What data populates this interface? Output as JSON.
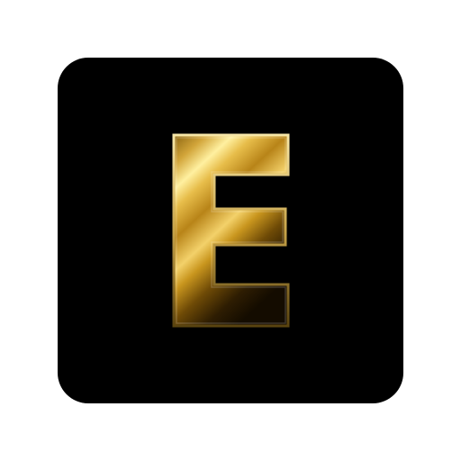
{
  "icon": {
    "name": "letter-e-icon",
    "letter": "E",
    "background_color": "#000000",
    "page_background_color": "#ffffff",
    "gold_colors": [
      "#fff4a8",
      "#e2b845",
      "#8a5a08",
      "#d09a22",
      "#2a1a02"
    ]
  }
}
